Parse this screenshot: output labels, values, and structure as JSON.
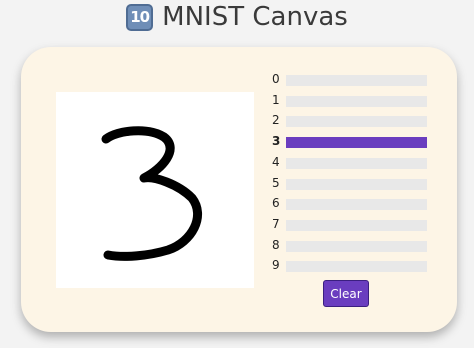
{
  "header": {
    "icon": "keycap-ten-icon",
    "icon_text": "10",
    "title": "MNIST Canvas"
  },
  "canvas": {
    "drawn_digit": "3",
    "stroke_color": "#000000"
  },
  "predictions": [
    {
      "digit": "0",
      "prob": 0.0
    },
    {
      "digit": "1",
      "prob": 0.0
    },
    {
      "digit": "2",
      "prob": 0.0
    },
    {
      "digit": "3",
      "prob": 1.0
    },
    {
      "digit": "4",
      "prob": 0.0
    },
    {
      "digit": "5",
      "prob": 0.0
    },
    {
      "digit": "6",
      "prob": 0.0
    },
    {
      "digit": "7",
      "prob": 0.0
    },
    {
      "digit": "8",
      "prob": 0.0
    },
    {
      "digit": "9",
      "prob": 0.0
    }
  ],
  "predicted": "3",
  "controls": {
    "clear_label": "Clear"
  },
  "colors": {
    "accent": "#6a3dbf",
    "card": "#fdf5e6",
    "track": "#e8e8e8"
  }
}
